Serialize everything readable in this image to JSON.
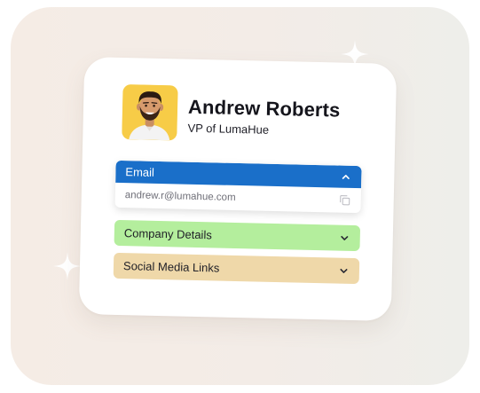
{
  "profile": {
    "name": "Andrew Roberts",
    "role": "VP of LumaHue",
    "avatar_bg": "#f7cc47"
  },
  "sections": {
    "email": {
      "label": "Email",
      "value": "andrew.r@lumahue.com",
      "expanded": true,
      "color": "#1a6fc9",
      "icon": "chevron-up-icon",
      "action_icon": "copy-icon"
    },
    "company": {
      "label": "Company Details",
      "expanded": false,
      "color": "#b4ee9d",
      "icon": "chevron-down-icon"
    },
    "social": {
      "label": "Social Media Links",
      "expanded": false,
      "color": "#efd8a9",
      "icon": "chevron-down-icon"
    }
  },
  "decorations": {
    "sparkle_icon": "sparkle-icon"
  }
}
